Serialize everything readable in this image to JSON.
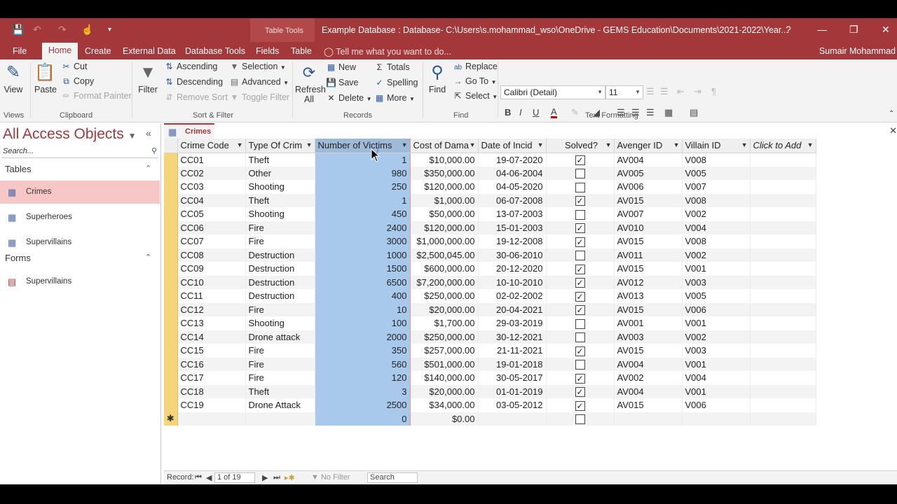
{
  "qat": {
    "save": "💾",
    "undo": "↶",
    "redo": "↷",
    "touch": "☝",
    "more": "▾"
  },
  "title": {
    "table_tools": "Table Tools",
    "document": "Example Database : Database- C:\\Users\\s.mohammad_wso\\OneDrive - GEMS Education\\Documents\\2021-2022\\Year...",
    "help": "?"
  },
  "tabs": [
    "File",
    "Home",
    "Create",
    "External Data",
    "Database Tools",
    "Fields",
    "Table"
  ],
  "tell_me": "Tell me what you want to do...",
  "user": "Sumair Mohammad",
  "ribbon": {
    "view": "View",
    "views_group": "Views",
    "paste": "Paste",
    "cut": "Cut",
    "copy": "Copy",
    "format_painter": "Format Painter",
    "clipboard_group": "Clipboard",
    "filter": "Filter",
    "ascending": "Ascending",
    "descending": "Descending",
    "remove_sort": "Remove Sort",
    "selection": "Selection",
    "advanced": "Advanced",
    "toggle_filter": "Toggle Filter",
    "sort_group": "Sort & Filter",
    "refresh": "Refresh",
    "refresh_all": "All",
    "new": "New",
    "save": "Save",
    "delete": "Delete",
    "totals": "Totals",
    "spelling": "Spelling",
    "more": "More",
    "records_group": "Records",
    "find": "Find",
    "replace": "Replace",
    "goto": "Go To",
    "select": "Select",
    "find_group": "Find",
    "font": "Calibri (Detail)",
    "size": "11",
    "text_group": "Text Formatting"
  },
  "nav": {
    "title": "All Access Objects",
    "search": "Search...",
    "tables_label": "Tables",
    "forms_label": "Forms",
    "tables": [
      "Crimes",
      "Superheroes",
      "Supervillains"
    ],
    "forms": [
      "Supervillains"
    ]
  },
  "doc_tab": "Crimes",
  "columns": [
    "Crime Code",
    "Type Of Crim",
    "Number of Victims",
    "Cost of Dama",
    "Date of Incid",
    "Solved?",
    "Avenger ID",
    "Villain ID",
    "Click to Add"
  ],
  "rows": [
    [
      "CC01",
      "Theft",
      "1",
      "$10,000.00",
      "19-07-2020",
      true,
      "AV004",
      "V008"
    ],
    [
      "CC02",
      "Other",
      "980",
      "$350,000.00",
      "04-06-2004",
      false,
      "AV005",
      "V005"
    ],
    [
      "CC03",
      "Shooting",
      "250",
      "$120,000.00",
      "04-05-2020",
      false,
      "AV006",
      "V007"
    ],
    [
      "CC04",
      "Theft",
      "1",
      "$1,000.00",
      "06-07-2008",
      true,
      "AV015",
      "V008"
    ],
    [
      "CC05",
      "Shooting",
      "450",
      "$50,000.00",
      "13-07-2003",
      false,
      "AV007",
      "V002"
    ],
    [
      "CC06",
      "Fire",
      "2400",
      "$120,000.00",
      "15-01-2003",
      true,
      "AV010",
      "V004"
    ],
    [
      "CC07",
      "Fire",
      "3000",
      "$1,000,000.00",
      "19-12-2008",
      true,
      "AV015",
      "V008"
    ],
    [
      "CC08",
      "Destruction",
      "1000",
      "$2,500,045.00",
      "30-06-2010",
      false,
      "AV011",
      "V002"
    ],
    [
      "CC09",
      "Destruction",
      "1500",
      "$600,000.00",
      "20-12-2020",
      true,
      "AV015",
      "V001"
    ],
    [
      "CC10",
      "Destruction",
      "6500",
      "$7,200,000.00",
      "10-10-2010",
      true,
      "AV012",
      "V003"
    ],
    [
      "CC11",
      "Destruction",
      "400",
      "$250,000.00",
      "02-02-2002",
      true,
      "AV013",
      "V005"
    ],
    [
      "CC12",
      "Fire",
      "10",
      "$20,000.00",
      "20-04-2021",
      true,
      "AV015",
      "V006"
    ],
    [
      "CC13",
      "Shooting",
      "100",
      "$1,700.00",
      "29-03-2019",
      false,
      "AV001",
      "V001"
    ],
    [
      "CC14",
      "Drone attack",
      "2000",
      "$250,000.00",
      "30-12-2021",
      false,
      "AV003",
      "V002"
    ],
    [
      "CC15",
      "Fire",
      "350",
      "$257,000.00",
      "21-11-2021",
      true,
      "AV015",
      "V003"
    ],
    [
      "CC16",
      "Fire",
      "560",
      "$501,000.00",
      "19-01-2018",
      false,
      "AV004",
      "V001"
    ],
    [
      "CC17",
      "Fire",
      "120",
      "$140,000.00",
      "30-05-2017",
      true,
      "AV002",
      "V004"
    ],
    [
      "CC18",
      "Theft",
      "3",
      "$20,000.00",
      "01-01-2019",
      true,
      "AV004",
      "V001"
    ],
    [
      "CC19",
      "Drone Attack",
      "2500",
      "$34,000.00",
      "03-05-2012",
      true,
      "AV015",
      "V006"
    ]
  ],
  "new_row": {
    "marker": "✱",
    "victims": "0",
    "cost": "$0.00"
  },
  "status": {
    "record_label": "Record:",
    "record_value": "1 of 19",
    "no_filter": "No Filter",
    "search": "Search"
  }
}
